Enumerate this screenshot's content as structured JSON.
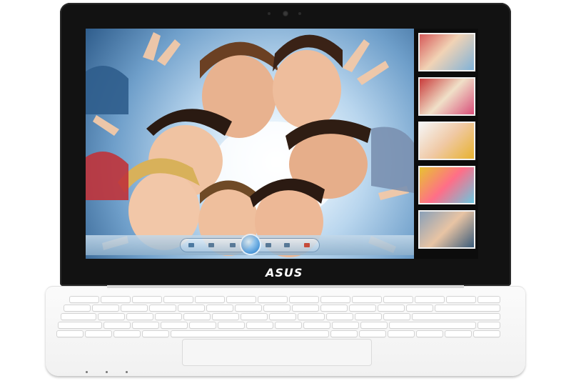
{
  "device": {
    "brand_logo_text": "ASUS",
    "body_color": "#f7f7f7",
    "bezel_color": "#121212"
  },
  "screen": {
    "main_photo": {
      "subject": "group-selfie-photo"
    },
    "thumbnails": [
      "thumb-1",
      "thumb-2",
      "thumb-3",
      "thumb-4",
      "thumb-5"
    ],
    "media_controls": [
      "prev-icon",
      "rewind-icon",
      "play-icon",
      "forward-icon",
      "next-icon",
      "close-icon"
    ]
  }
}
